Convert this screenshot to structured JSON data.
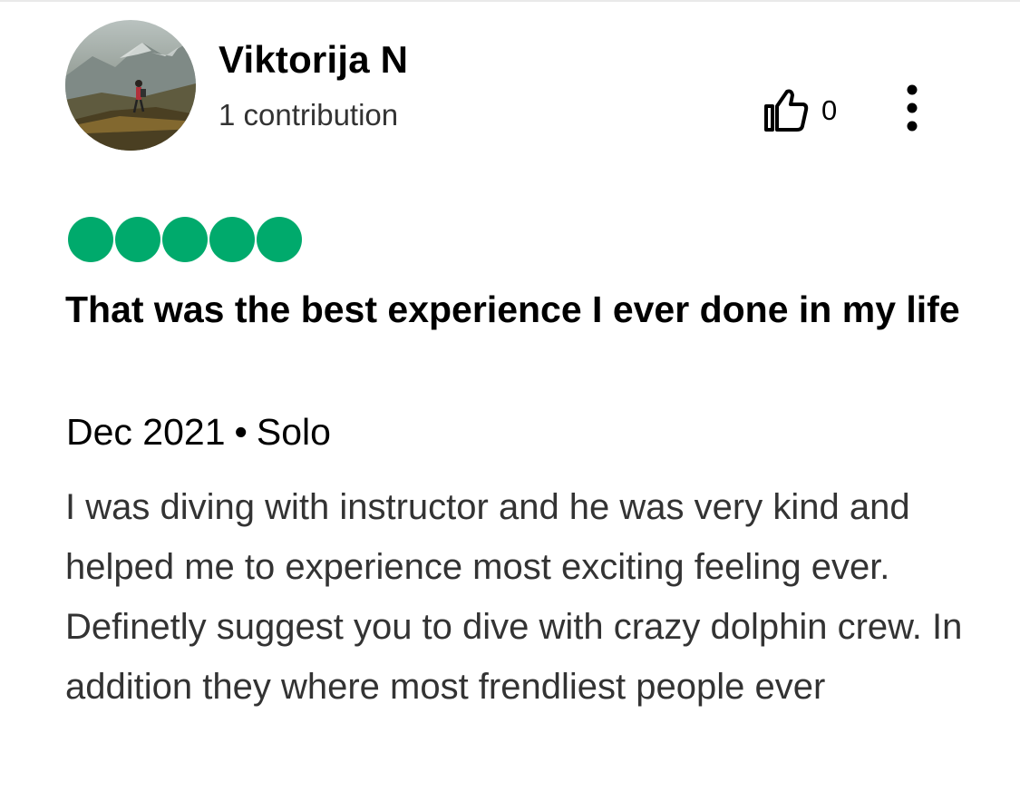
{
  "reviewer": {
    "name": "Viktorija N",
    "contributions": "1 contribution",
    "avatar": "hiker-on-mountain-photo"
  },
  "actions": {
    "helpful_icon": "thumbs-up-icon",
    "helpful_count": "0",
    "more_icon": "vertical-ellipsis-icon"
  },
  "rating": {
    "value": 5,
    "max": 5,
    "color": "#00aa6c"
  },
  "review": {
    "title": "That was the best experience I ever done in my life",
    "date": "Dec 2021",
    "separator": "•",
    "trip_type": "Solo",
    "text": "I was diving with instructor and he was very kind and helped me to experience most exciting feeling ever. Definetly suggest you to dive with crazy dolphin crew. In addition they where most frendliest people ever"
  }
}
